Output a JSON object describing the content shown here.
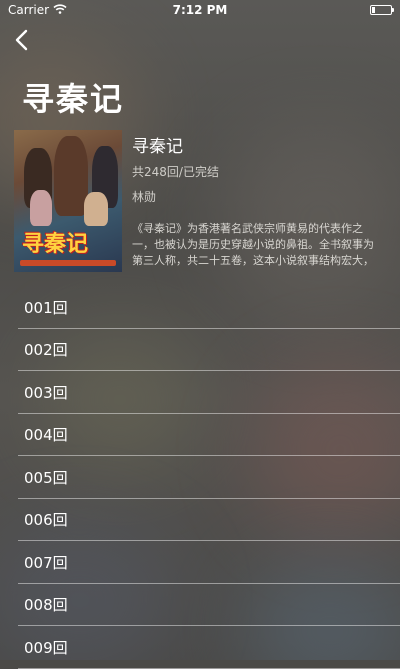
{
  "status": {
    "carrier": "Carrier",
    "time": "7:12 PM",
    "battery_level": 0.15
  },
  "nav": {
    "back_icon": "chevron-left-icon"
  },
  "page_title": "寻秦记",
  "show": {
    "name": "寻秦记",
    "meta": "共248回/已完结",
    "actor": "林勋",
    "description": "《寻秦记》为香港著名武侠宗师黄易的代表作之一，也被认为是历史穿越小说的鼻祖。全书叙事为第三人称，共二十五卷，这本小说叙事结构宏大，人物塑造丰满而深具魅力；并且剧情跌宕...",
    "cover_logo": "寻秦记"
  },
  "episodes": [
    {
      "label": "001回"
    },
    {
      "label": "002回"
    },
    {
      "label": "003回"
    },
    {
      "label": "004回"
    },
    {
      "label": "005回"
    },
    {
      "label": "006回"
    },
    {
      "label": "007回"
    },
    {
      "label": "008回"
    },
    {
      "label": "009回"
    }
  ]
}
